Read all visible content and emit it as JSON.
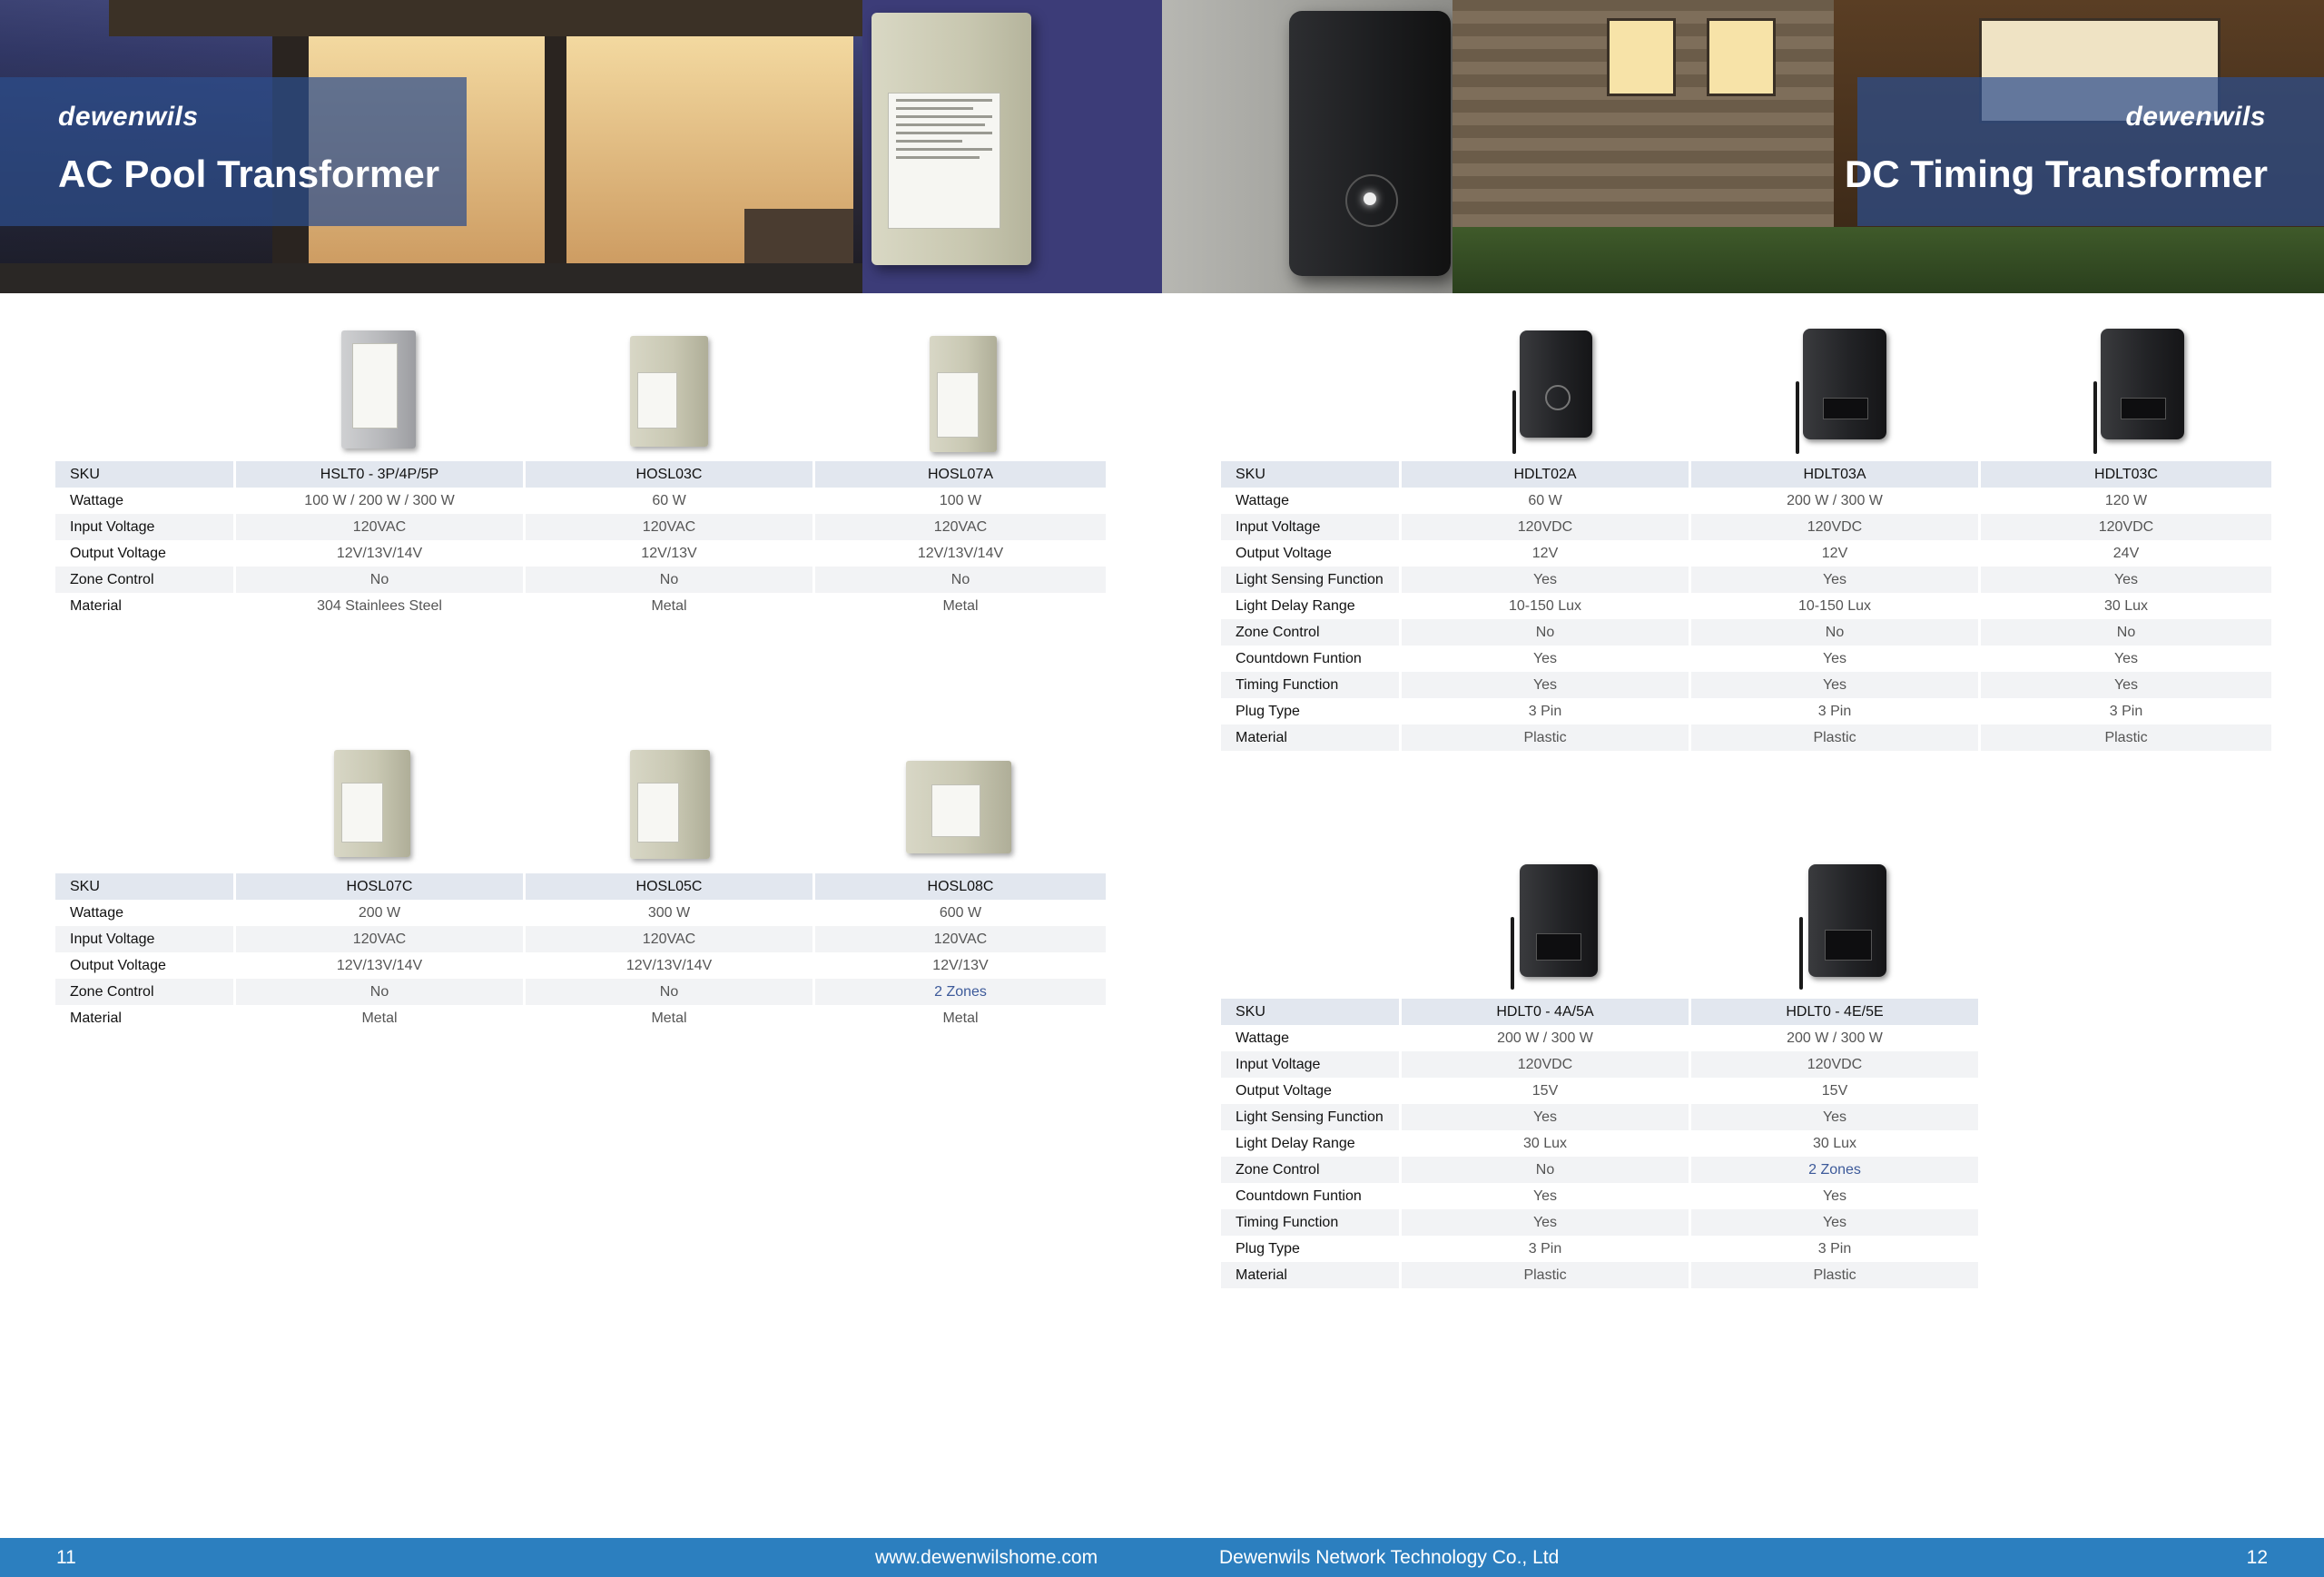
{
  "brand": "dewenwils",
  "left_page": {
    "hero_title": "AC Pool Transformer",
    "page_number": "11",
    "footer_url": "www.dewenwilshome.com",
    "row_labels": [
      "SKU",
      "Wattage",
      "Input Voltage",
      "Output Voltage",
      "Zone Control",
      "Material"
    ],
    "table1": {
      "products": [
        {
          "sku": "HSLT0 - 3P/4P/5P",
          "wattage": "100 W / 200 W / 300 W",
          "input_voltage": "120VAC",
          "output_voltage": "12V/13V/14V",
          "zone_control": "No",
          "material": "304 Stainlees Steel"
        },
        {
          "sku": "HOSL03C",
          "wattage": "60 W",
          "input_voltage": "120VAC",
          "output_voltage": "12V/13V",
          "zone_control": "No",
          "material": "Metal"
        },
        {
          "sku": "HOSL07A",
          "wattage": "100 W",
          "input_voltage": "120VAC",
          "output_voltage": "12V/13V/14V",
          "zone_control": "No",
          "material": "Metal"
        }
      ]
    },
    "table2": {
      "products": [
        {
          "sku": "HOSL07C",
          "wattage": "200 W",
          "input_voltage": "120VAC",
          "output_voltage": "12V/13V/14V",
          "zone_control": "No",
          "material": "Metal"
        },
        {
          "sku": "HOSL05C",
          "wattage": "300 W",
          "input_voltage": "120VAC",
          "output_voltage": "12V/13V/14V",
          "zone_control": "No",
          "material": "Metal"
        },
        {
          "sku": "HOSL08C",
          "wattage": "600 W",
          "input_voltage": "120VAC",
          "output_voltage": "12V/13V",
          "zone_control": "2 Zones",
          "material": "Metal"
        }
      ]
    }
  },
  "right_page": {
    "hero_title": "DC Timing Transformer",
    "page_number": "12",
    "footer_company": "Dewenwils Network Technology Co., Ltd",
    "row_labels": [
      "SKU",
      "Wattage",
      "Input Voltage",
      "Output Voltage",
      "Light Sensing Function",
      "Light Delay Range",
      "Zone Control",
      "Countdown Funtion",
      "Timing Function",
      "Plug Type",
      "Material"
    ],
    "table1": {
      "products": [
        {
          "sku": "HDLT02A",
          "wattage": "60 W",
          "input_voltage": "120VDC",
          "output_voltage": "12V",
          "light_sensing": "Yes",
          "light_delay": "10-150 Lux",
          "zone_control": "No",
          "countdown": "Yes",
          "timing": "Yes",
          "plug_type": "3 Pin",
          "material": "Plastic"
        },
        {
          "sku": "HDLT03A",
          "wattage": "200 W / 300 W",
          "input_voltage": "120VDC",
          "output_voltage": "12V",
          "light_sensing": "Yes",
          "light_delay": "10-150 Lux",
          "zone_control": "No",
          "countdown": "Yes",
          "timing": "Yes",
          "plug_type": "3 Pin",
          "material": "Plastic"
        },
        {
          "sku": "HDLT03C",
          "wattage": "120 W",
          "input_voltage": "120VDC",
          "output_voltage": "24V",
          "light_sensing": "Yes",
          "light_delay": "30 Lux",
          "zone_control": "No",
          "countdown": "Yes",
          "timing": "Yes",
          "plug_type": "3 Pin",
          "material": "Plastic"
        }
      ]
    },
    "table2": {
      "products": [
        {
          "sku": "HDLT0 - 4A/5A",
          "wattage": "200 W / 300 W",
          "input_voltage": "120VDC",
          "output_voltage": "15V",
          "light_sensing": "Yes",
          "light_delay": "30 Lux",
          "zone_control": "No",
          "countdown": "Yes",
          "timing": "Yes",
          "plug_type": "3 Pin",
          "material": "Plastic"
        },
        {
          "sku": "HDLT0 - 4E/5E",
          "wattage": "200 W / 300 W",
          "input_voltage": "120VDC",
          "output_voltage": "15V",
          "light_sensing": "Yes",
          "light_delay": "30 Lux",
          "zone_control": "2 Zones",
          "countdown": "Yes",
          "timing": "Yes",
          "plug_type": "3 Pin",
          "material": "Plastic"
        }
      ]
    }
  },
  "colors": {
    "footer_bar": "#2c7fbf",
    "hero_band": "#2c4e8c",
    "table_header": "#e2e7ef",
    "zones_text": "#3d5a9a"
  }
}
